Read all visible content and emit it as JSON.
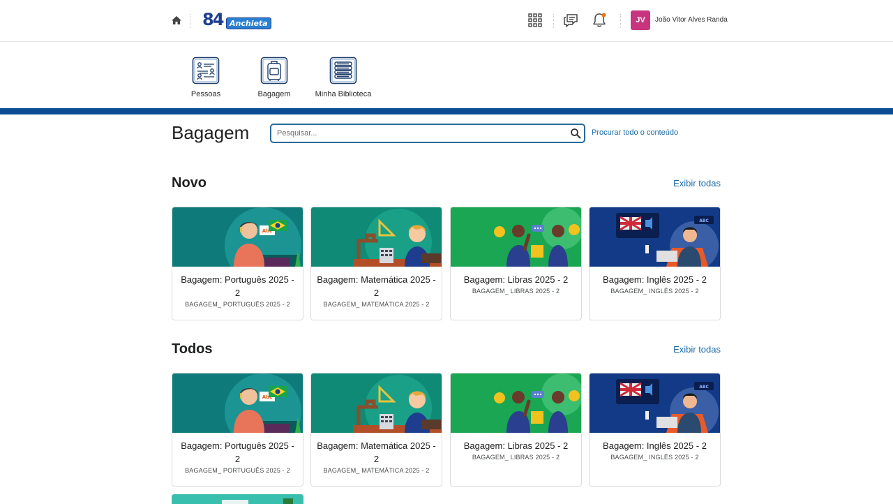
{
  "header": {
    "logo_number": "84",
    "logo_brand": "Anchieta",
    "user_initials": "JV",
    "user_name": "João Vitor Alves Randa",
    "colors": {
      "avatar": "#c8357e",
      "notification_dot": "#e8761b"
    }
  },
  "nav": {
    "items": [
      {
        "label": "Pessoas",
        "icon": "people-list-icon"
      },
      {
        "label": "Bagagem",
        "icon": "luggage-icon"
      },
      {
        "label": "Minha Biblioteca",
        "icon": "books-icon"
      }
    ],
    "bar_color": "#0a4d93"
  },
  "page": {
    "title": "Bagagem",
    "search_placeholder": "Pesquisar...",
    "search_all_label": "Procurar todo o conteúdo"
  },
  "sections": [
    {
      "title": "Novo",
      "link": "Exibir todas",
      "cards": [
        {
          "title": "Bagagem: Português 2025 - 2",
          "subtitle": "BAGAGEM_ PORTUGUÊS 2025 - 2"
        },
        {
          "title": "Bagagem: Matemática 2025 - 2",
          "subtitle": "BAGAGEM_ MATEMÁTICA 2025 - 2"
        },
        {
          "title": "Bagagem: Libras 2025 - 2",
          "subtitle": "BAGAGEM_ LIBRAS 2025 - 2"
        },
        {
          "title": "Bagagem: Inglês 2025 - 2",
          "subtitle": "BAGAGEM_ INGLÊS 2025 - 2"
        }
      ]
    },
    {
      "title": "Todos",
      "link": "Exibir todas",
      "cards": [
        {
          "title": "Bagagem: Português 2025 - 2",
          "subtitle": "BAGAGEM_ PORTUGUÊS 2025 - 2"
        },
        {
          "title": "Bagagem: Matemática 2025 - 2",
          "subtitle": "BAGAGEM_ MATEMÁTICA 2025 - 2"
        },
        {
          "title": "Bagagem: Libras 2025 - 2",
          "subtitle": "BAGAGEM_ LIBRAS 2025 - 2"
        },
        {
          "title": "Bagagem: Inglês 2025 - 2",
          "subtitle": "BAGAGEM_ INGLÊS 2025 - 2"
        }
      ]
    }
  ]
}
